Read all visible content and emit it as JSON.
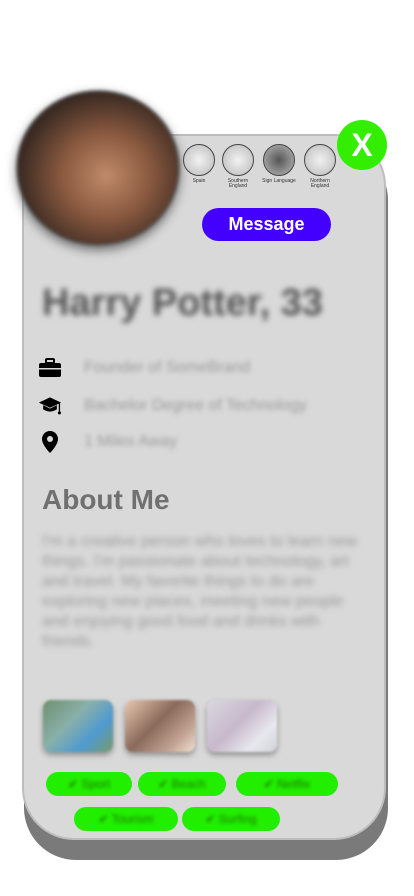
{
  "profile": {
    "name": "Harry Potter, 33",
    "occupation": "Founder of SomeBrand",
    "education": "Bachelor Degree of Technology",
    "location": "1 Miles Away"
  },
  "actions": {
    "close_label": "X",
    "message_label": "Message"
  },
  "languages": [
    {
      "label": "Spain"
    },
    {
      "label": "Southern England"
    },
    {
      "label": "Sign Language"
    },
    {
      "label": "Northern England"
    }
  ],
  "about": {
    "title": "About Me",
    "text": "I'm a creative person who loves to learn new things. I'm passionate about technology, art and travel. My favorite things to do are exploring new places, meeting new people and enjoying good food and drinks with friends."
  },
  "interests": [
    {
      "label": "✔ Sport"
    },
    {
      "label": "✔ Beach"
    },
    {
      "label": "✔ Netflix"
    },
    {
      "label": "✔ Tourism"
    },
    {
      "label": "✔ Surfing"
    }
  ],
  "colors": {
    "accent": "#4400ff",
    "close": "#33ee00",
    "tag": "#22ee00",
    "card": "#d9d9d9"
  }
}
